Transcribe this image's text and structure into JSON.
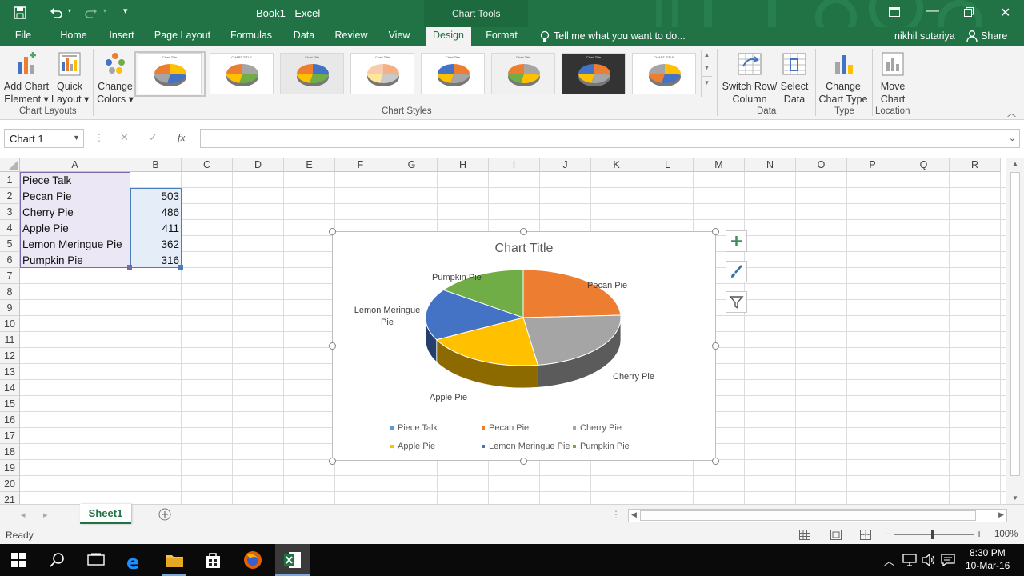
{
  "titlebar": {
    "doc_title": "Book1 - Excel",
    "context_label": "Chart Tools"
  },
  "tabs": [
    "File",
    "Home",
    "Insert",
    "Page Layout",
    "Formulas",
    "Data",
    "Review",
    "View",
    "Design",
    "Format"
  ],
  "tell_me": "Tell me what you want to do...",
  "user": "nikhil sutariya",
  "share": "Share",
  "ribbon": {
    "add_chart_element": [
      "Add Chart",
      "Element"
    ],
    "quick_layout": [
      "Quick",
      "Layout"
    ],
    "change_colors": [
      "Change",
      "Colors"
    ],
    "switch_row_col": [
      "Switch Row/",
      "Column"
    ],
    "select_data": [
      "Select",
      "Data"
    ],
    "change_chart_type": [
      "Change",
      "Chart Type"
    ],
    "move_chart": [
      "Move",
      "Chart"
    ],
    "groups": {
      "chart_layouts": "Chart Layouts",
      "chart_styles": "Chart Styles",
      "data": "Data",
      "type": "Type",
      "location": "Location"
    },
    "style_thumb_titles": [
      "Chart Title",
      "CHART TITLE",
      "Chart Title",
      "Chart Title",
      "Chart Title",
      "Chart Title",
      "Chart Title",
      "CHART TITLE"
    ]
  },
  "formula_bar": {
    "name_box": "Chart 1",
    "fx": "fx",
    "content": ""
  },
  "columns": [
    "A",
    "B",
    "C",
    "D",
    "E",
    "F",
    "G",
    "H",
    "I",
    "J",
    "K",
    "L",
    "M",
    "N",
    "O",
    "P",
    "Q",
    "R"
  ],
  "rows": [
    "1",
    "2",
    "3",
    "4",
    "5",
    "6",
    "7",
    "8",
    "9",
    "10",
    "11",
    "12",
    "13",
    "14",
    "15",
    "16",
    "17",
    "18",
    "19",
    "20",
    "21"
  ],
  "cells": {
    "a1": "Piece Talk",
    "a2": "Pecan Pie",
    "b2": "503",
    "a3": "Cherry Pie",
    "b3": "486",
    "a4": "Apple Pie",
    "b4": "411",
    "a5": "Lemon Meringue Pie",
    "b5": "362",
    "a6": "Pumpkin Pie",
    "b6": "316"
  },
  "chart_data": {
    "type": "pie",
    "title": "Chart Title",
    "categories": [
      "Pecan Pie",
      "Cherry Pie",
      "Apple Pie",
      "Lemon Meringue Pie",
      "Pumpkin Pie"
    ],
    "values": [
      503,
      486,
      411,
      362,
      316
    ],
    "colors": [
      "#ed7d31",
      "#a5a5a5",
      "#ffc000",
      "#4472c4",
      "#70ad47"
    ],
    "legend": [
      "Piece Talk",
      "Pecan Pie",
      "Cherry Pie",
      "Apple Pie",
      "Lemon Meringue Pie",
      "Pumpkin Pie"
    ],
    "legend_colors": [
      "#5b9bd5",
      "#ed7d31",
      "#a5a5a5",
      "#ffc000",
      "#4472c4",
      "#70ad47"
    ],
    "data_labels": {
      "pecan": "Pecan Pie",
      "cherry": "Cherry Pie",
      "apple": "Apple Pie",
      "lemon1": "Lemon Meringue",
      "lemon2": "Pie",
      "pumpkin": "Pumpkin Pie"
    },
    "legend_position": "bottom"
  },
  "sheet_tab": "Sheet1",
  "status": {
    "ready": "Ready",
    "zoom": "100%"
  },
  "clock": {
    "time": "8:30 PM",
    "date": "10-Mar-16"
  }
}
